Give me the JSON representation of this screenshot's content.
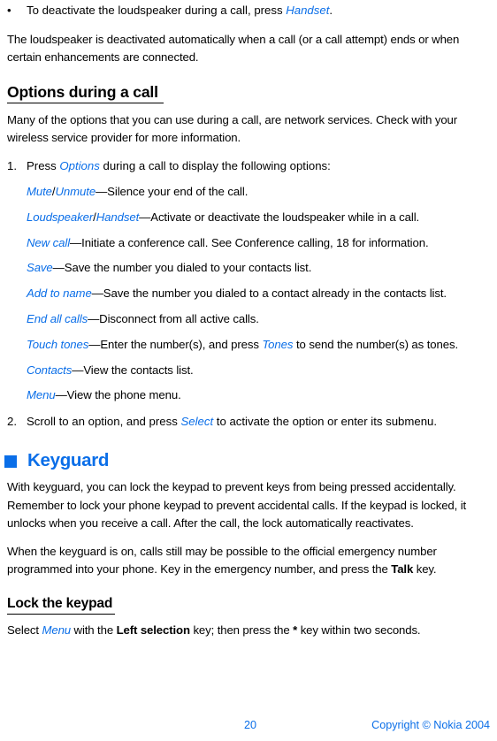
{
  "document": {
    "accent_color": "#0a6ee8",
    "text_color": "#000000",
    "background_color": "#ffffff"
  },
  "bullet_item": {
    "marker": "•",
    "fragments": [
      {
        "text": "To deactivate the loudspeaker during a call, press ",
        "style": "plain"
      },
      {
        "text": "Handset",
        "style": "ui"
      },
      {
        "text": ".",
        "style": "plain"
      }
    ]
  },
  "intro_paragraph": {
    "fragments": [
      {
        "text": "The loudspeaker is deactivated automatically when a call (or a call attempt) ends or when certain enhancements are connected.",
        "style": "plain"
      }
    ]
  },
  "options_heading": {
    "label": "Options during a call"
  },
  "options_intro": {
    "fragments": [
      {
        "text": "Many of the options that you can use during a call, are network services. Check with your wireless service provider for more information.",
        "style": "plain"
      }
    ]
  },
  "step_one": {
    "marker": "1.",
    "fragments": [
      {
        "text": "Press ",
        "style": "plain"
      },
      {
        "text": "Options",
        "style": "ui"
      },
      {
        "text": " during a call to display the following options:",
        "style": "plain"
      }
    ]
  },
  "option_lines": [
    {
      "name": "mute-unmute",
      "fragments": [
        {
          "text": "Mute",
          "style": "ui"
        },
        {
          "text": "/",
          "style": "sep"
        },
        {
          "text": "Unmute",
          "style": "ui"
        },
        {
          "text": "—Silence your end of the call.",
          "style": "plain"
        }
      ]
    },
    {
      "name": "loudspeaker-handset",
      "fragments": [
        {
          "text": "Loudspeaker",
          "style": "ui"
        },
        {
          "text": "/",
          "style": "sep"
        },
        {
          "text": "Handset",
          "style": "ui"
        },
        {
          "text": "—Activate or deactivate the loudspeaker while in a call.",
          "style": "plain"
        }
      ]
    },
    {
      "name": "new-call",
      "fragments": [
        {
          "text": "New call",
          "style": "ui"
        },
        {
          "text": "—Initiate a conference call. See Conference calling, 18 for information.",
          "style": "plain"
        }
      ]
    },
    {
      "name": "save",
      "fragments": [
        {
          "text": "Save",
          "style": "ui"
        },
        {
          "text": "—Save the number you dialed to your contacts list.",
          "style": "plain"
        }
      ]
    },
    {
      "name": "add-to-name",
      "fragments": [
        {
          "text": "Add to name",
          "style": "ui"
        },
        {
          "text": "—Save the number you dialed to a contact already in the contacts list.",
          "style": "plain"
        }
      ]
    },
    {
      "name": "end-all-calls",
      "fragments": [
        {
          "text": "End all calls",
          "style": "ui"
        },
        {
          "text": "—Disconnect from all active calls.",
          "style": "plain"
        }
      ]
    },
    {
      "name": "touch-tones",
      "fragments": [
        {
          "text": "Touch tones",
          "style": "ui"
        },
        {
          "text": "—Enter the number(s), and press ",
          "style": "plain"
        },
        {
          "text": "Tones",
          "style": "ui"
        },
        {
          "text": " to send the number(s) as tones.",
          "style": "plain"
        }
      ]
    },
    {
      "name": "contacts",
      "fragments": [
        {
          "text": "Contacts",
          "style": "ui"
        },
        {
          "text": "—View the contacts list.",
          "style": "plain"
        }
      ]
    },
    {
      "name": "menu",
      "fragments": [
        {
          "text": "Menu",
          "style": "ui"
        },
        {
          "text": "—View the phone menu.",
          "style": "plain"
        }
      ]
    }
  ],
  "step_two": {
    "marker": "2.",
    "fragments": [
      {
        "text": "Scroll to an option, and press ",
        "style": "plain"
      },
      {
        "text": "Select",
        "style": "ui"
      },
      {
        "text": " to activate the option or enter its submenu.",
        "style": "plain"
      }
    ]
  },
  "keyguard_heading": {
    "label": "Keyguard",
    "square_icon": "filled-square-icon"
  },
  "keyguard_paragraph_one": {
    "fragments": [
      {
        "text": "With keyguard, you can lock the keypad to prevent keys from being pressed accidentally. Remember to lock your phone keypad to prevent accidental calls. If the keypad is locked, it unlocks when you receive a call. After the call, the lock automatically reactivates.",
        "style": "plain"
      }
    ]
  },
  "keyguard_paragraph_two": {
    "fragments": [
      {
        "text": "When the keyguard is on, calls still may be possible to the official emergency number programmed into your phone. Key in the emergency number, and press the ",
        "style": "plain"
      },
      {
        "text": "Talk",
        "style": "bold"
      },
      {
        "text": " key.",
        "style": "plain"
      }
    ]
  },
  "lock_keypad_heading": {
    "label": "Lock the keypad"
  },
  "lock_keypad_paragraph": {
    "fragments": [
      {
        "text": "Select ",
        "style": "plain"
      },
      {
        "text": "Menu",
        "style": "ui"
      },
      {
        "text": " with the ",
        "style": "plain"
      },
      {
        "text": "Left selection",
        "style": "bold"
      },
      {
        "text": " key; then press the ",
        "style": "plain"
      },
      {
        "text": "*",
        "style": "bold"
      },
      {
        "text": " key within two seconds.",
        "style": "plain"
      }
    ]
  },
  "footer": {
    "page_number": "20",
    "copyright": "Copyright © Nokia 2004"
  }
}
